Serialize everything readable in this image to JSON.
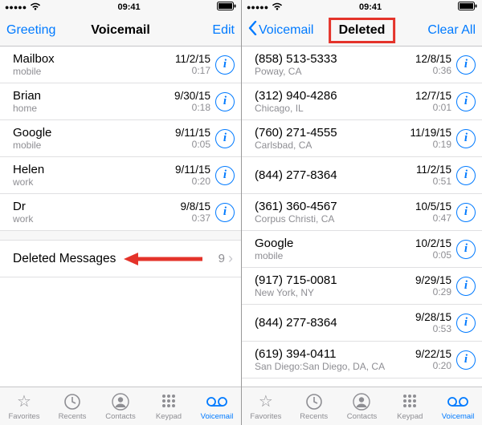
{
  "status": {
    "time": "09:41"
  },
  "left_screen": {
    "nav": {
      "left": "Greeting",
      "title": "Voicemail",
      "right": "Edit"
    },
    "rows": [
      {
        "name": "Mailbox",
        "sub": "mobile",
        "date": "11/2/15",
        "dur": "0:17"
      },
      {
        "name": "Brian",
        "sub": "home",
        "date": "9/30/15",
        "dur": "0:18"
      },
      {
        "name": "Google",
        "sub": "mobile",
        "date": "9/11/15",
        "dur": "0:05"
      },
      {
        "name": "Helen",
        "sub": "work",
        "date": "9/11/15",
        "dur": "0:20"
      },
      {
        "name": "Dr",
        "sub": "work",
        "date": "9/8/15",
        "dur": "0:37"
      }
    ],
    "deleted": {
      "label": "Deleted Messages",
      "count": "9"
    }
  },
  "right_screen": {
    "nav": {
      "back": "Voicemail",
      "title": "Deleted",
      "right": "Clear All"
    },
    "rows": [
      {
        "name": "(858) 513-5333",
        "sub": "Poway, CA",
        "date": "12/8/15",
        "dur": "0:36"
      },
      {
        "name": "(312) 940-4286",
        "sub": "Chicago, IL",
        "date": "12/7/15",
        "dur": "0:01"
      },
      {
        "name": "(760) 271-4555",
        "sub": "Carlsbad, CA",
        "date": "11/19/15",
        "dur": "0:19"
      },
      {
        "name": "(844) 277-8364",
        "sub": "",
        "date": "11/2/15",
        "dur": "0:51"
      },
      {
        "name": "(361) 360-4567",
        "sub": "Corpus Christi, CA",
        "date": "10/5/15",
        "dur": "0:47"
      },
      {
        "name": "Google",
        "sub": "mobile",
        "date": "10/2/15",
        "dur": "0:05"
      },
      {
        "name": "(917) 715-0081",
        "sub": "New York, NY",
        "date": "9/29/15",
        "dur": "0:29"
      },
      {
        "name": "(844) 277-8364",
        "sub": "",
        "date": "9/28/15",
        "dur": "0:53"
      },
      {
        "name": "(619) 394-0411",
        "sub": "San Diego:San Diego, DA, CA",
        "date": "9/22/15",
        "dur": "0:20"
      }
    ]
  },
  "tabs": {
    "favorites": "Favorites",
    "recents": "Recents",
    "contacts": "Contacts",
    "keypad": "Keypad",
    "voicemail": "Voicemail"
  }
}
